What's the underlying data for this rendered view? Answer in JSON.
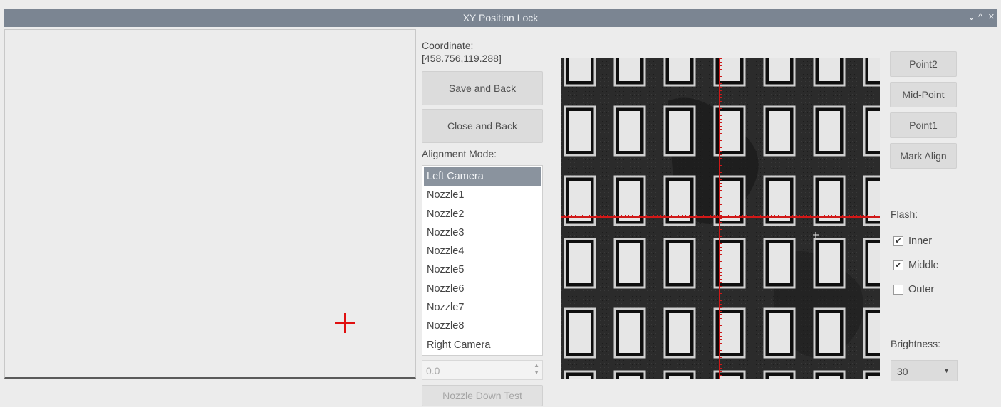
{
  "window": {
    "title": "XY Position Lock",
    "controls": [
      "⌄",
      "^",
      "×"
    ]
  },
  "coordinate": {
    "label": "Coordinate:",
    "value": "[458.756,119.288]"
  },
  "buttons": {
    "save_back": "Save and Back",
    "close_back": "Close and Back",
    "nozzle_test": "Nozzle Down Test",
    "point2": "Point2",
    "mid_point": "Mid-Point",
    "point1": "Point1",
    "mark_align": "Mark Align"
  },
  "alignment": {
    "label": "Alignment Mode:",
    "selected_index": 0,
    "items": [
      "Left Camera",
      "Nozzle1",
      "Nozzle2",
      "Nozzle3",
      "Nozzle4",
      "Nozzle5",
      "Nozzle6",
      "Nozzle7",
      "Nozzle8",
      "Right Camera"
    ]
  },
  "spinbox": {
    "value": "0.0"
  },
  "flash": {
    "label": "Flash:",
    "options": [
      {
        "label": "Inner",
        "checked": true
      },
      {
        "label": "Middle",
        "checked": true
      },
      {
        "label": "Outer",
        "checked": false
      }
    ]
  },
  "brightness": {
    "label": "Brightness:",
    "value": "30"
  },
  "colors": {
    "titlebar": "#7b8592",
    "crosshair": "#e01010",
    "selection": "#8a939e"
  }
}
